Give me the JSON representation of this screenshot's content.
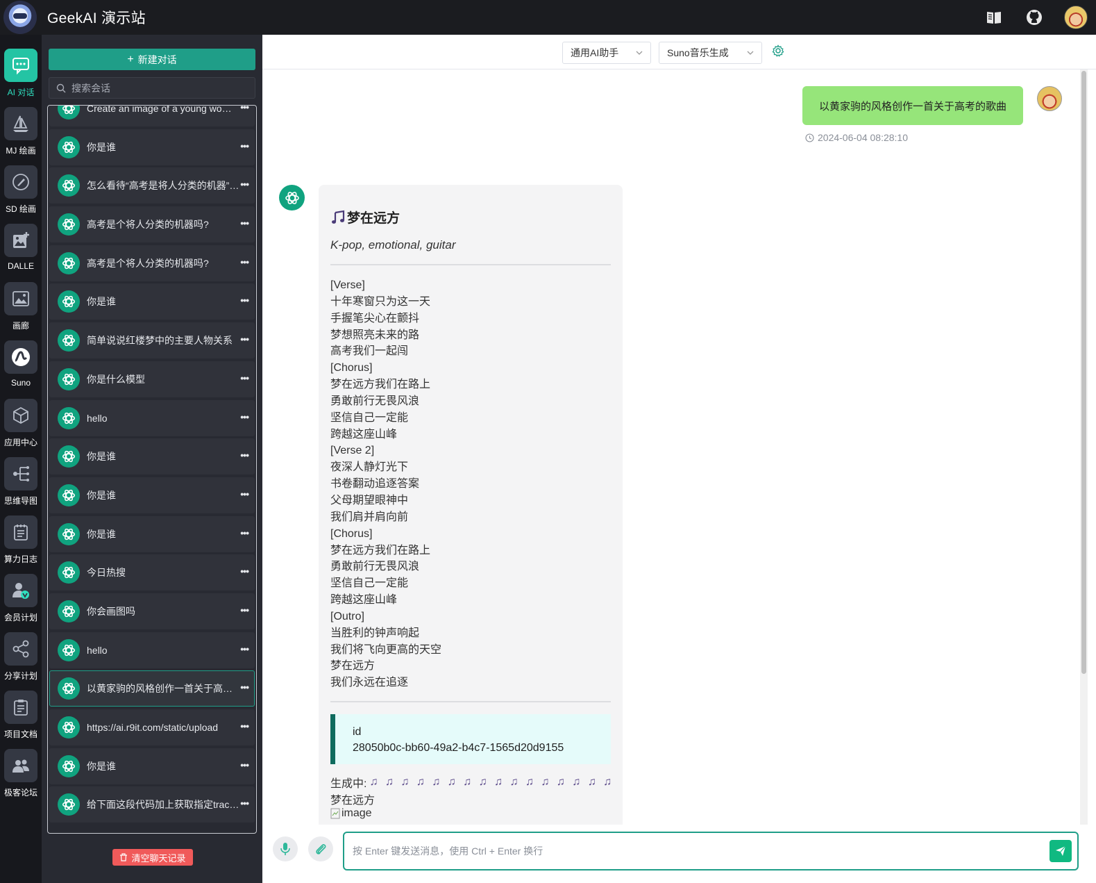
{
  "header": {
    "title": "GeekAI 演示站",
    "icons": [
      "docs-icon",
      "github-icon",
      "user-avatar"
    ]
  },
  "rail": {
    "items": [
      {
        "label": "AI 对话",
        "icon": "chat-icon",
        "active": true
      },
      {
        "label": "MJ 绘画",
        "icon": "sailboat-icon"
      },
      {
        "label": "SD 绘画",
        "icon": "brush-icon"
      },
      {
        "label": "DALLE",
        "icon": "image-add-icon"
      },
      {
        "label": "画廊",
        "icon": "gallery-icon"
      },
      {
        "label": "Suno",
        "icon": "music-wave-icon"
      },
      {
        "label": "应用中心",
        "icon": "cube-icon"
      },
      {
        "label": "思维导图",
        "icon": "mindmap-icon"
      },
      {
        "label": "算力日志",
        "icon": "log-icon"
      },
      {
        "label": "会员计划",
        "icon": "vip-icon"
      },
      {
        "label": "分享计划",
        "icon": "share-icon"
      },
      {
        "label": "项目文档",
        "icon": "document-icon"
      },
      {
        "label": "极客论坛",
        "icon": "forum-icon"
      }
    ]
  },
  "sidebar": {
    "new_chat_label": "新建对话",
    "search_placeholder": "搜索会话",
    "clear_label": "清空聊天记录",
    "chats": [
      {
        "title": "Create an image of a young woman"
      },
      {
        "title": "你是谁"
      },
      {
        "title": "怎么看待“高考是将人分类的机器”这个说法"
      },
      {
        "title": "高考是个将人分类的机器吗?"
      },
      {
        "title": "高考是个将人分类的机器吗?"
      },
      {
        "title": "你是谁"
      },
      {
        "title": "简单说说红楼梦中的主要人物关系"
      },
      {
        "title": "你是什么模型"
      },
      {
        "title": "hello"
      },
      {
        "title": "你是谁"
      },
      {
        "title": "你是谁"
      },
      {
        "title": "你是谁"
      },
      {
        "title": "今日热搜"
      },
      {
        "title": "你会画图吗"
      },
      {
        "title": "hello"
      },
      {
        "title": "以黄家驹的风格创作一首关于高考的歌曲",
        "active": true
      },
      {
        "title": "https://ai.r9it.com/static/upload"
      },
      {
        "title": "你是谁"
      },
      {
        "title": "给下面这段代码加上获取指定track的功能"
      }
    ],
    "more_glyph": "•••"
  },
  "toolbar": {
    "role_select": "通用AI助手",
    "model_select": "Suno音乐生成"
  },
  "conversation": {
    "user_message": "以黄家驹的风格创作一首关于高考的歌曲",
    "user_time": "2024-06-04 08:28:10",
    "song_title": "梦在远方",
    "song_style": "K-pop, emotional, guitar",
    "lyrics": [
      "[Verse]",
      "十年寒窗只为这一天",
      "手握笔尖心在颤抖",
      "梦想照亮未来的路",
      "高考我们一起闯",
      "[Chorus]",
      "梦在远方我们在路上",
      "勇敢前行无畏风浪",
      "坚信自己一定能",
      "跨越这座山峰",
      "[Verse 2]",
      "夜深人静灯光下",
      "书卷翻动追逐答案",
      "父母期望眼神中",
      "我们肩并肩向前",
      "[Chorus]",
      "梦在远方我们在路上",
      "勇敢前行无畏风浪",
      "坚信自己一定能",
      "跨越这座山峰",
      "[Outro]",
      "当胜利的钟声响起",
      "我们将飞向更高的天空",
      "梦在远方",
      "我们永远在追逐"
    ],
    "id_label": "id",
    "id_value": "28050b0c-bb60-49a2-b4c7-1565d20d9155",
    "generating_label": "生成中:",
    "generating_notes": "♫ ♫ ♫ ♫ ♫ ♫ ♫ ♫ ♫ ♫ ♫ ♫ ♫ ♫ ♫ ♫",
    "after_title": "梦在远方",
    "image_alt": "image"
  },
  "composer": {
    "placeholder": "按 Enter 键发送消息，使用 Ctrl + Enter 换行"
  },
  "colors": {
    "accent": "#1f9e88",
    "user_bubble": "#96e57a",
    "danger": "#f05a5a",
    "dark_bg": "#1b1c20"
  }
}
